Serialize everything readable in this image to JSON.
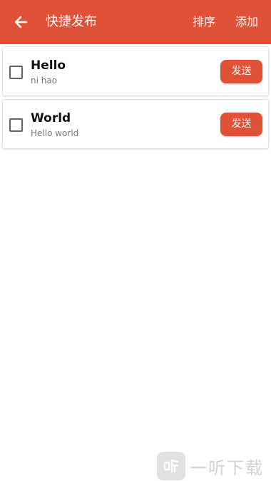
{
  "toolbar": {
    "title": "快捷发布",
    "sort_label": "排序",
    "add_label": "添加",
    "back_icon": "arrow-left-icon",
    "background_color": "#e05238",
    "text_color": "#ffffff"
  },
  "items": [
    {
      "title": "Hello",
      "subtitle": "ni hao",
      "checked": false,
      "send_label": "发送"
    },
    {
      "title": "World",
      "subtitle": "Hello world",
      "checked": false,
      "send_label": "发送"
    }
  ],
  "watermark": {
    "text": "一听下载",
    "logo_icon": "ting-logo-icon"
  },
  "colors": {
    "accent": "#e05238"
  }
}
